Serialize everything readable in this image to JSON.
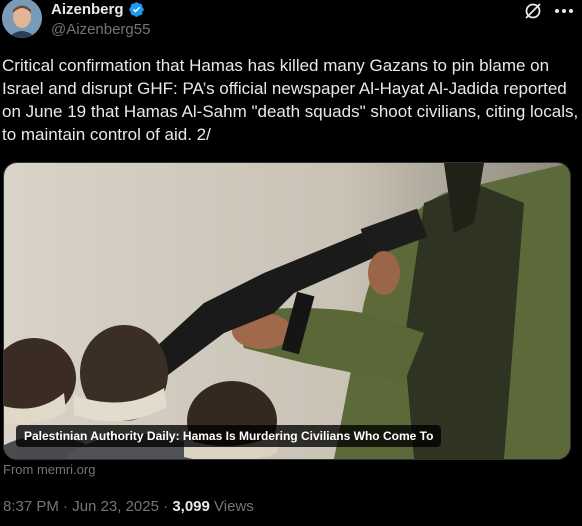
{
  "author": {
    "display_name": "Aizenberg",
    "handle": "@Aizenberg55",
    "verified": true
  },
  "icons": {
    "avatar": "avatar-photo",
    "verified": "verified-badge-icon",
    "grok": "grok-icon",
    "more": "more-options-icon"
  },
  "tweet": {
    "text": "Critical confirmation that Hamas has killed many Gazans to pin blame on Israel and disrupt GHF: PA’s official newspaper Al-Hayat Al-Jadida reported on June 19 that Hamas Al-Sahm \"death squads\" shoot civilians, citing locals, to maintain control of aid. 2/"
  },
  "media": {
    "caption": "Palestinian Authority Daily: Hamas Is Murdering Civilians Who Come To",
    "source": "From memri.org"
  },
  "meta": {
    "time": "8:37 PM",
    "date": "Jun 23, 2025",
    "separator": "·",
    "views_count": "3,099",
    "views_label": "Views"
  },
  "colors": {
    "background": "#000000",
    "text": "#e7e9ea",
    "muted": "#71767b",
    "verified_blue": "#1d9bf0"
  }
}
